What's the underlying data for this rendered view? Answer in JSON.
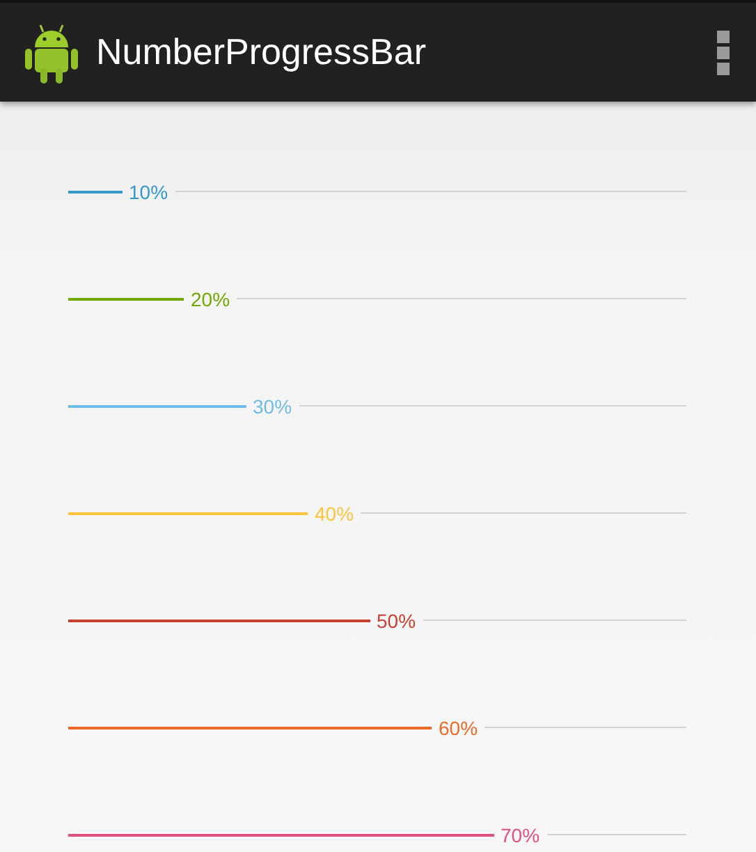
{
  "action_bar": {
    "title": "NumberProgressBar"
  },
  "progress_bars": [
    {
      "level": 0.1,
      "reading": "10%",
      "color": "#3498c9"
    },
    {
      "level": 0.2,
      "reading": "20%",
      "color": "#70a800"
    },
    {
      "level": 0.3,
      "reading": "30%",
      "color": "#6cbde6"
    },
    {
      "level": 0.4,
      "reading": "40%",
      "color": "#fcc43e"
    },
    {
      "level": 0.5,
      "reading": "50%",
      "color": "#c6402f"
    },
    {
      "level": 0.6,
      "reading": "60%",
      "color": "#eb6a2a"
    },
    {
      "level": 0.7,
      "reading": "70%",
      "color": "#e0507d"
    }
  ]
}
